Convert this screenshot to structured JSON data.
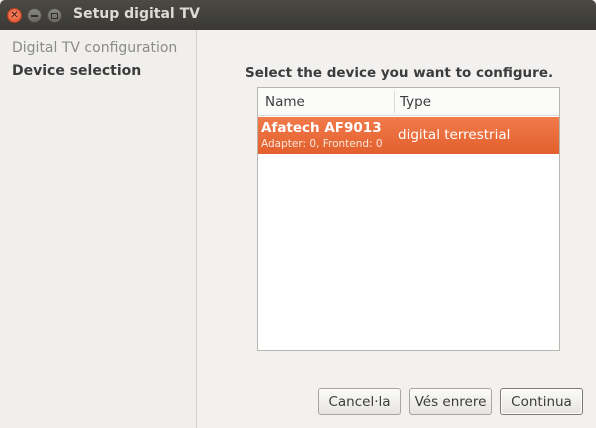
{
  "window": {
    "title": "Setup digital TV",
    "controls": {
      "close": "close-icon",
      "minimize": "minimize-icon",
      "maximize": "maximize-icon"
    }
  },
  "sidebar": {
    "steps": [
      {
        "label": "Digital TV configuration",
        "state": "done"
      },
      {
        "label": "Device selection",
        "state": "current"
      }
    ]
  },
  "main": {
    "prompt": "Select the device you want to configure.",
    "table": {
      "columns": [
        "Name",
        "Type"
      ],
      "rows": [
        {
          "name": "Afatech AF9013",
          "details": "Adapter: 0, Frontend: 0",
          "type": "digital terrestrial",
          "selected": true
        }
      ]
    }
  },
  "buttons": {
    "cancel": "Cancel·la",
    "back": "Vés enrere",
    "next": "Continua"
  },
  "colors": {
    "selection": "#e9673a",
    "titlebar": "#403f3a",
    "background": "#f2f1f0"
  }
}
